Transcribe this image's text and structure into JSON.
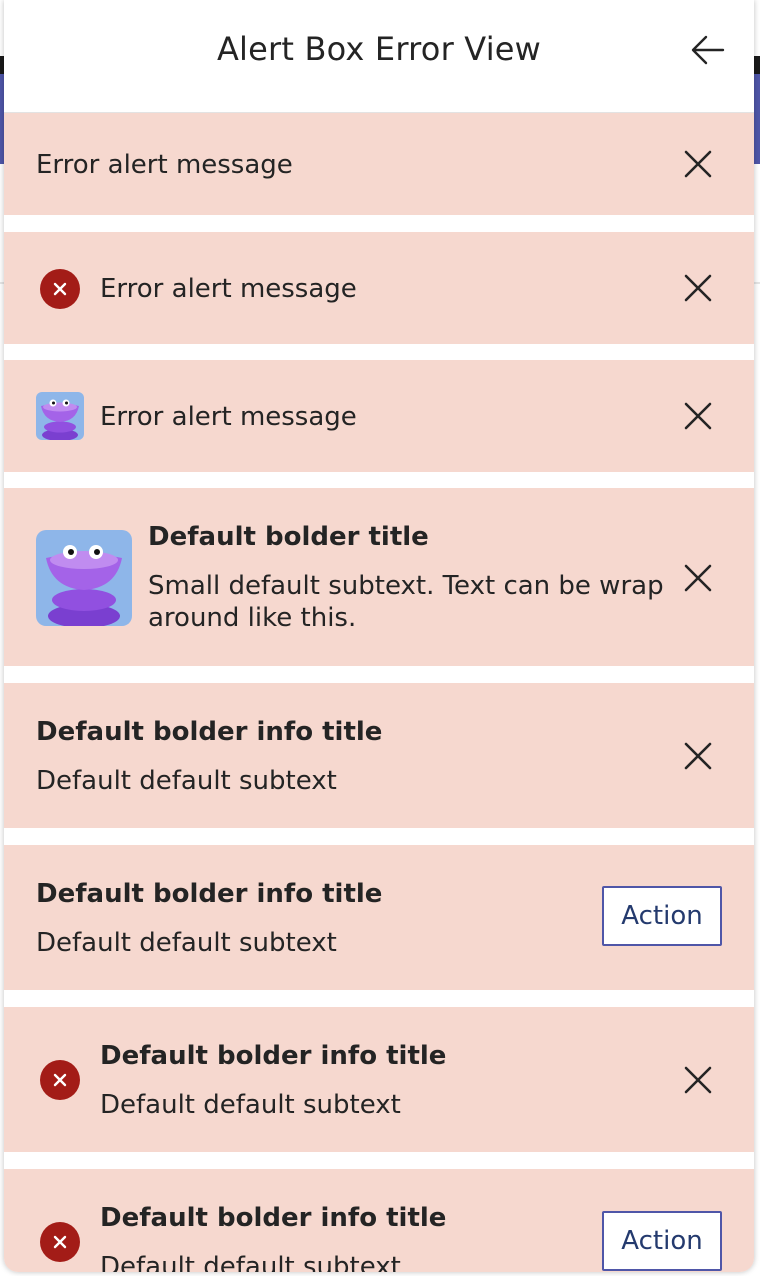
{
  "header": {
    "title": "Alert Box Error View"
  },
  "alerts": [
    {
      "message": "Error alert message"
    },
    {
      "message": "Error alert message"
    },
    {
      "message": "Error alert message"
    },
    {
      "title": "Default bolder title",
      "subtext": "Small default subtext. Text can be wrap around like this."
    },
    {
      "title": "Default bolder info title",
      "subtext": "Default default subtext"
    },
    {
      "title": "Default bolder info title",
      "subtext": "Default default subtext",
      "action": "Action"
    },
    {
      "title": "Default bolder info title",
      "subtext": "Default default subtext"
    },
    {
      "title": "Default bolder info title",
      "subtext": "Default default subtext",
      "action": "Action"
    }
  ],
  "colors": {
    "alert_bg": "#f6d8cf",
    "error_icon": "#a31c17",
    "action_border": "#4f56a8",
    "text": "#242424"
  },
  "icons": {
    "back": "arrow-left-icon",
    "close": "close-icon",
    "error": "error-circle-icon",
    "avatar": "purple-creature-avatar"
  }
}
